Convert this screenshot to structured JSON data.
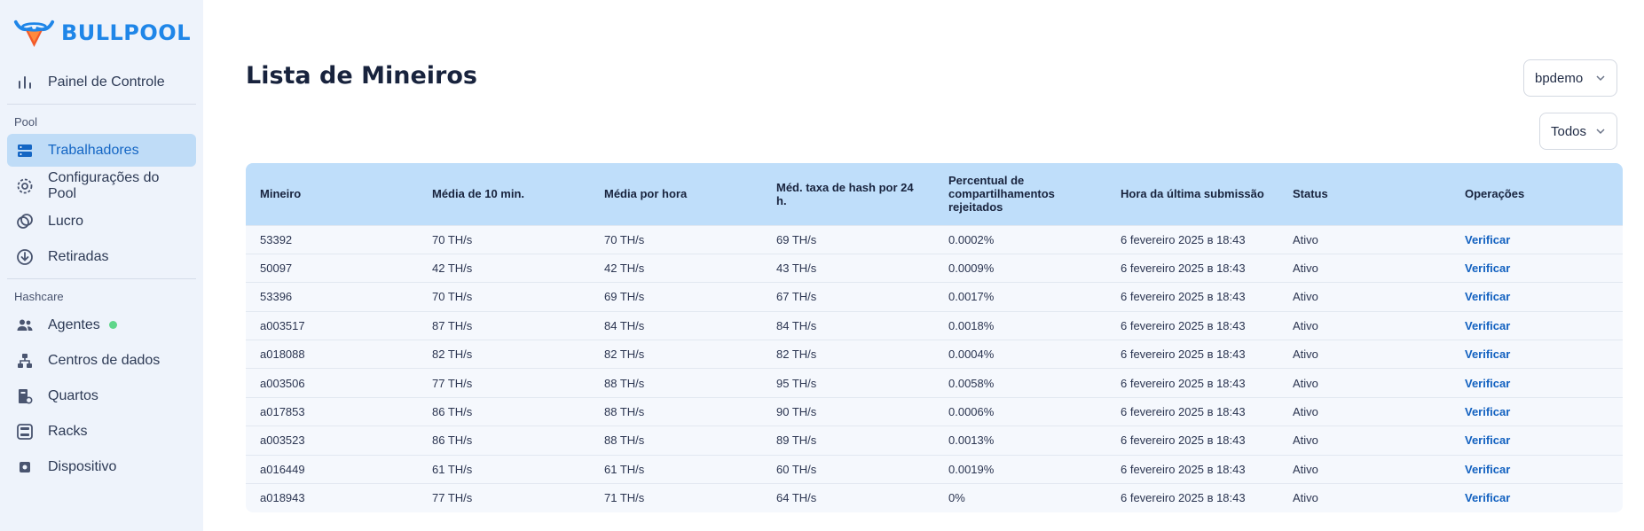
{
  "brand": {
    "name": "BULLPOOL"
  },
  "sidebar": {
    "top_item": {
      "label": "Painel de Controle",
      "icon": "bar-chart-icon"
    },
    "pool_section": {
      "label": "Pool",
      "items": [
        {
          "label": "Trabalhadores",
          "icon": "server-icon",
          "active": true
        },
        {
          "label": "Configurações do Pool",
          "icon": "gear-icon"
        },
        {
          "label": "Lucro",
          "icon": "coins-icon"
        },
        {
          "label": "Retiradas",
          "icon": "download-circle-icon"
        }
      ]
    },
    "hashcare_section": {
      "label": "Hashcare",
      "items": [
        {
          "label": "Agentes",
          "icon": "users-icon",
          "status_color": "#5fd68a"
        },
        {
          "label": "Centros de dados",
          "icon": "sitemap-icon"
        },
        {
          "label": "Quartos",
          "icon": "room-icon"
        },
        {
          "label": "Racks",
          "icon": "rack-icon"
        },
        {
          "label": "Dispositivo",
          "icon": "chip-icon"
        }
      ]
    }
  },
  "main": {
    "title": "Lista de Mineiros",
    "user_select": "bpdemo",
    "filter_select": "Todos"
  },
  "table": {
    "headers": [
      "Mineiro",
      "Média de 10 min.",
      "Média por hora",
      "Méd. taxa de hash por 24 h.",
      "Percentual de compartilhamentos rejeitados",
      "Hora da última submissão",
      "Status",
      "Operações"
    ],
    "rows": [
      [
        "53392",
        "70 TH/s",
        "70 TH/s",
        "69 TH/s",
        "0.0002%",
        "6 fevereiro 2025 в 18:43",
        "Ativo",
        "Verificar"
      ],
      [
        "50097",
        "42 TH/s",
        "42 TH/s",
        "43 TH/s",
        "0.0009%",
        "6 fevereiro 2025 в 18:43",
        "Ativo",
        "Verificar"
      ],
      [
        "53396",
        "70 TH/s",
        "69 TH/s",
        "67 TH/s",
        "0.0017%",
        "6 fevereiro 2025 в 18:43",
        "Ativo",
        "Verificar"
      ],
      [
        "a003517",
        "87 TH/s",
        "84 TH/s",
        "84 TH/s",
        "0.0018%",
        "6 fevereiro 2025 в 18:43",
        "Ativo",
        "Verificar"
      ],
      [
        "a018088",
        "82 TH/s",
        "82 TH/s",
        "82 TH/s",
        "0.0004%",
        "6 fevereiro 2025 в 18:43",
        "Ativo",
        "Verificar"
      ],
      [
        "a003506",
        "77 TH/s",
        "88 TH/s",
        "95 TH/s",
        "0.0058%",
        "6 fevereiro 2025 в 18:43",
        "Ativo",
        "Verificar"
      ],
      [
        "a017853",
        "86 TH/s",
        "88 TH/s",
        "90 TH/s",
        "0.0006%",
        "6 fevereiro 2025 в 18:43",
        "Ativo",
        "Verificar"
      ],
      [
        "a003523",
        "86 TH/s",
        "88 TH/s",
        "89 TH/s",
        "0.0013%",
        "6 fevereiro 2025 в 18:43",
        "Ativo",
        "Verificar"
      ],
      [
        "a016449",
        "61 TH/s",
        "61 TH/s",
        "60 TH/s",
        "0.0019%",
        "6 fevereiro 2025 в 18:43",
        "Ativo",
        "Verificar"
      ],
      [
        "a018943",
        "77 TH/s",
        "71 TH/s",
        "64 TH/s",
        "0%",
        "6 fevereiro 2025 в 18:43",
        "Ativo",
        "Verificar"
      ]
    ]
  },
  "colors": {
    "accent": "#1f86e8",
    "active_bg": "#bfdcf7",
    "header_bg": "#bfdefa",
    "link": "#1261c0"
  }
}
